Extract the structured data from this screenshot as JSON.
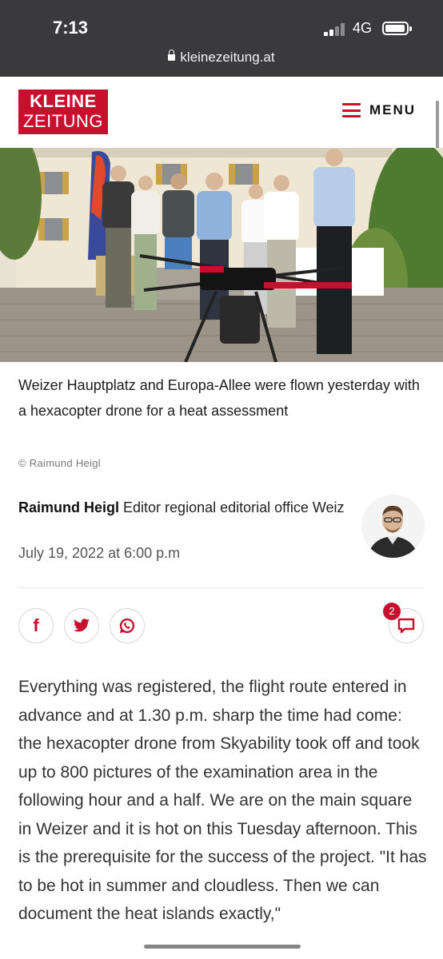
{
  "status_bar": {
    "time": "7:13",
    "network": "4G",
    "url": "kleinezeitung.at"
  },
  "header": {
    "logo_line1": "KLEINE",
    "logo_line2": "ZEITUNG",
    "menu_label": "MENU",
    "brand_color": "#c8102e"
  },
  "article": {
    "image_caption": "Weizer Hauptplatz and Europa-Allee were flown yesterday with a hexacopter drone for a heat assessment",
    "image_credit": "© Raimund Heigl",
    "author_name": "Raimund Heigl",
    "author_role": "Editor regional editorial office Weiz",
    "date": "July 19, 2022 at 6:00 p.m",
    "comment_count": "2",
    "share_icons": [
      "facebook-icon",
      "twitter-icon",
      "whatsapp-icon"
    ],
    "body": "Everything was registered, the flight route entered in advance and at 1.30 p.m. sharp the time had come: the hexacopter drone from Skyability took off and took up to 800 pictures of the examination area in the following hour and a half. We are on the main square in Weizer and it is hot on this Tuesday afternoon. This is the prerequisite for the success of the project. \"It has to be hot in summer and cloudless. Then we can document the heat islands exactly,\""
  }
}
